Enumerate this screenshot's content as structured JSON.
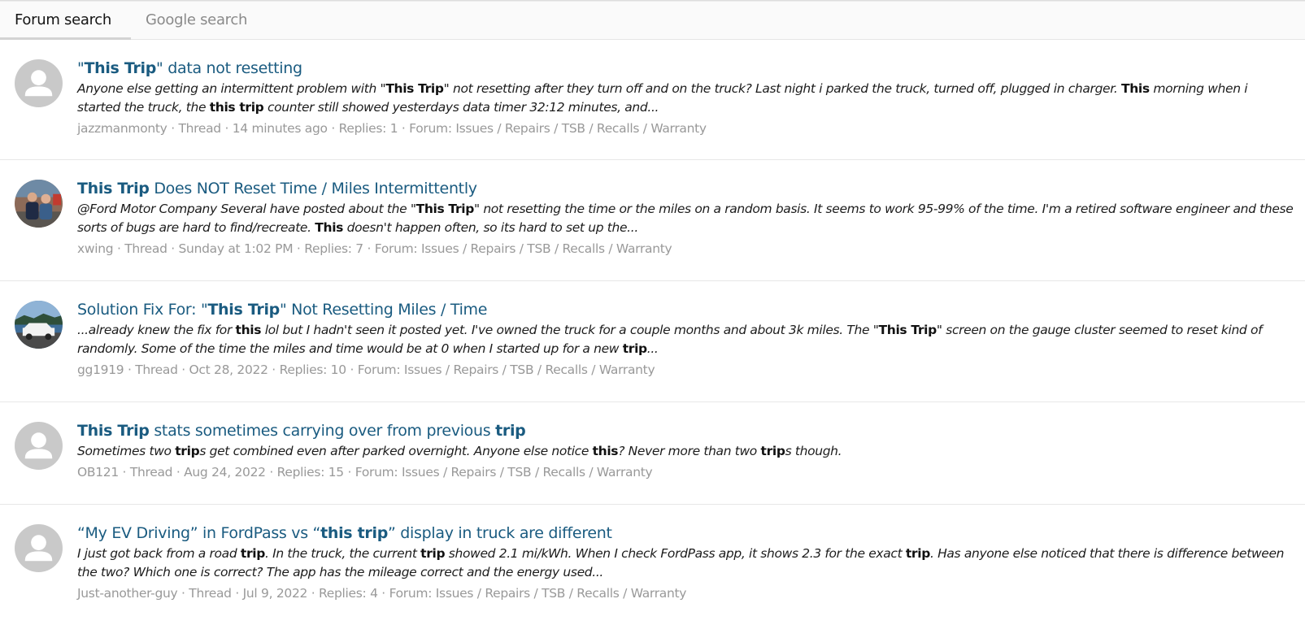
{
  "tabs": [
    {
      "label": "Forum search",
      "active": true
    },
    {
      "label": "Google search",
      "active": false
    }
  ],
  "colors": {
    "title": "#1a5b80",
    "meta": "#999999",
    "avatar_placeholder_bg": "#c9c9c9"
  },
  "results": [
    {
      "title": [
        {
          "text": "\"",
          "b": false
        },
        {
          "text": "This Trip",
          "b": true
        },
        {
          "text": "\" data not resetting",
          "b": false
        }
      ],
      "snippet": [
        {
          "text": "Anyone else getting an intermittent problem with \"",
          "b": false
        },
        {
          "text": "This Trip",
          "b": true
        },
        {
          "text": "\" not resetting after they turn off and on the truck? Last night i parked the truck, turned off, plugged in charger. ",
          "b": false
        },
        {
          "text": "This",
          "b": true
        },
        {
          "text": " morning when i started the truck, the ",
          "b": false
        },
        {
          "text": "this trip",
          "b": true
        },
        {
          "text": " counter still showed yesterdays data timer 32:12 minutes, and...",
          "b": false
        }
      ],
      "author": "jazzmanmonty",
      "type": "Thread",
      "date": "14 minutes ago",
      "replies": "Replies: 1",
      "forum_prefix": "Forum:",
      "forum": "Issues / Repairs / TSB / Recalls / Warranty",
      "avatar": "placeholder-person-icon"
    },
    {
      "title": [
        {
          "text": "This Trip",
          "b": true
        },
        {
          "text": " Does NOT Reset Time / Miles Intermittently",
          "b": false
        }
      ],
      "snippet": [
        {
          "text": "@Ford Motor Company Several have posted about the \"",
          "b": false
        },
        {
          "text": "This Trip",
          "b": true
        },
        {
          "text": "\" not resetting the time or the miles on a random basis. It seems to work 95-99% of the time. I'm a retired software engineer and these sorts of bugs are hard to find/recreate. ",
          "b": false
        },
        {
          "text": "This",
          "b": true
        },
        {
          "text": " doesn't happen often, so its hard to set up the...",
          "b": false
        }
      ],
      "author": "xwing",
      "type": "Thread",
      "date": "Sunday at 1:02 PM",
      "replies": "Replies: 7",
      "forum_prefix": "Forum:",
      "forum": "Issues / Repairs / TSB / Recalls / Warranty",
      "avatar": "photo-two-people"
    },
    {
      "title": [
        {
          "text": "Solution Fix For: \"",
          "b": false
        },
        {
          "text": "This Trip",
          "b": true
        },
        {
          "text": "\" Not Resetting Miles / Time",
          "b": false
        }
      ],
      "snippet": [
        {
          "text": "...already knew the fix for ",
          "b": false
        },
        {
          "text": "this",
          "b": true
        },
        {
          "text": " lol but I hadn't seen it posted yet. I've owned the truck for a couple months and about 3k miles. The \"",
          "b": false
        },
        {
          "text": "This Trip",
          "b": true
        },
        {
          "text": "\" screen on the gauge cluster seemed to reset kind of randomly. Some of the time the miles and time would be at 0 when I started up for a new ",
          "b": false
        },
        {
          "text": "trip",
          "b": true
        },
        {
          "text": "...",
          "b": false
        }
      ],
      "author": "gg1919",
      "type": "Thread",
      "date": "Oct 28, 2022",
      "replies": "Replies: 10",
      "forum_prefix": "Forum:",
      "forum": "Issues / Repairs / TSB / Recalls / Warranty",
      "avatar": "photo-white-truck"
    },
    {
      "title": [
        {
          "text": "This Trip",
          "b": true
        },
        {
          "text": " stats sometimes carrying over from previous ",
          "b": false
        },
        {
          "text": "trip",
          "b": true
        }
      ],
      "snippet": [
        {
          "text": "Sometimes two ",
          "b": false
        },
        {
          "text": "trip",
          "b": true
        },
        {
          "text": "s get combined even after parked overnight. Anyone else notice ",
          "b": false
        },
        {
          "text": "this",
          "b": true
        },
        {
          "text": "? Never more than two ",
          "b": false
        },
        {
          "text": "trip",
          "b": true
        },
        {
          "text": "s though.",
          "b": false
        }
      ],
      "author": "OB121",
      "type": "Thread",
      "date": "Aug 24, 2022",
      "replies": "Replies: 15",
      "forum_prefix": "Forum:",
      "forum": "Issues / Repairs / TSB / Recalls / Warranty",
      "avatar": "placeholder-person-icon"
    },
    {
      "title": [
        {
          "text": "“My EV Driving” in FordPass vs “",
          "b": false
        },
        {
          "text": "this trip",
          "b": true
        },
        {
          "text": "” display in truck are different",
          "b": false
        }
      ],
      "snippet": [
        {
          "text": "I just got back from a road ",
          "b": false
        },
        {
          "text": "trip",
          "b": true
        },
        {
          "text": ". In the truck, the current ",
          "b": false
        },
        {
          "text": "trip",
          "b": true
        },
        {
          "text": " showed 2.1 mi/kWh. When I check FordPass app, it shows 2.3 for the exact ",
          "b": false
        },
        {
          "text": "trip",
          "b": true
        },
        {
          "text": ". Has anyone else noticed that there is difference between the two? Which one is correct? The app has the mileage correct and the energy used...",
          "b": false
        }
      ],
      "author": "Just-another-guy",
      "type": "Thread",
      "date": "Jul 9, 2022",
      "replies": "Replies: 4",
      "forum_prefix": "Forum:",
      "forum": "Issues / Repairs / TSB / Recalls / Warranty",
      "avatar": "placeholder-person-icon"
    }
  ]
}
